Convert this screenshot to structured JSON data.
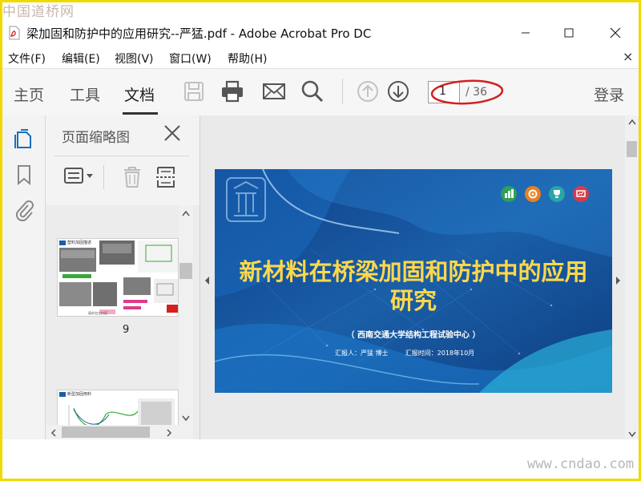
{
  "watermark": {
    "top": "中国道桥网",
    "bottom": "www.cndao.com"
  },
  "window": {
    "title": "梁加固和防护中的应用研究--严猛.pdf - Adobe Acrobat Pro DC"
  },
  "menu": [
    {
      "label": "文件(F)"
    },
    {
      "label": "编辑(E)"
    },
    {
      "label": "视图(V)"
    },
    {
      "label": "窗口(W)"
    },
    {
      "label": "帮助(H)"
    }
  ],
  "menu_close": "×",
  "tabs": {
    "home": "主页",
    "tools": "工具",
    "document": "文档"
  },
  "toolbar_icons": [
    "save-icon",
    "print-icon",
    "email-icon",
    "search-icon",
    "prev-page-icon",
    "next-page-icon"
  ],
  "page_nav": {
    "current": "1",
    "total": "/ 36"
  },
  "login": "登录",
  "thumbnail_panel": {
    "title": "页面缩略图",
    "thumbnails": [
      {
        "page_label": "9",
        "heading": "塑料加固描述",
        "footer_text": "填补加工内容"
      },
      {
        "heading": "新型加固用料"
      }
    ]
  },
  "slide": {
    "title_line1": "新材料在桥梁加固和防护中的应用",
    "title_line2": "研究",
    "org": "（ 西南交通大学结构工程试验中心 ）",
    "reporter": "汇报人：严猛    博士",
    "report_time": "汇报时间：2018年10月"
  },
  "colors": {
    "frame": "#f0d800",
    "slide_title": "#ffd84a",
    "slide_bg": "#1a5fa8",
    "annotation": "#d42020",
    "accent_blue": "#1b6ec2"
  }
}
